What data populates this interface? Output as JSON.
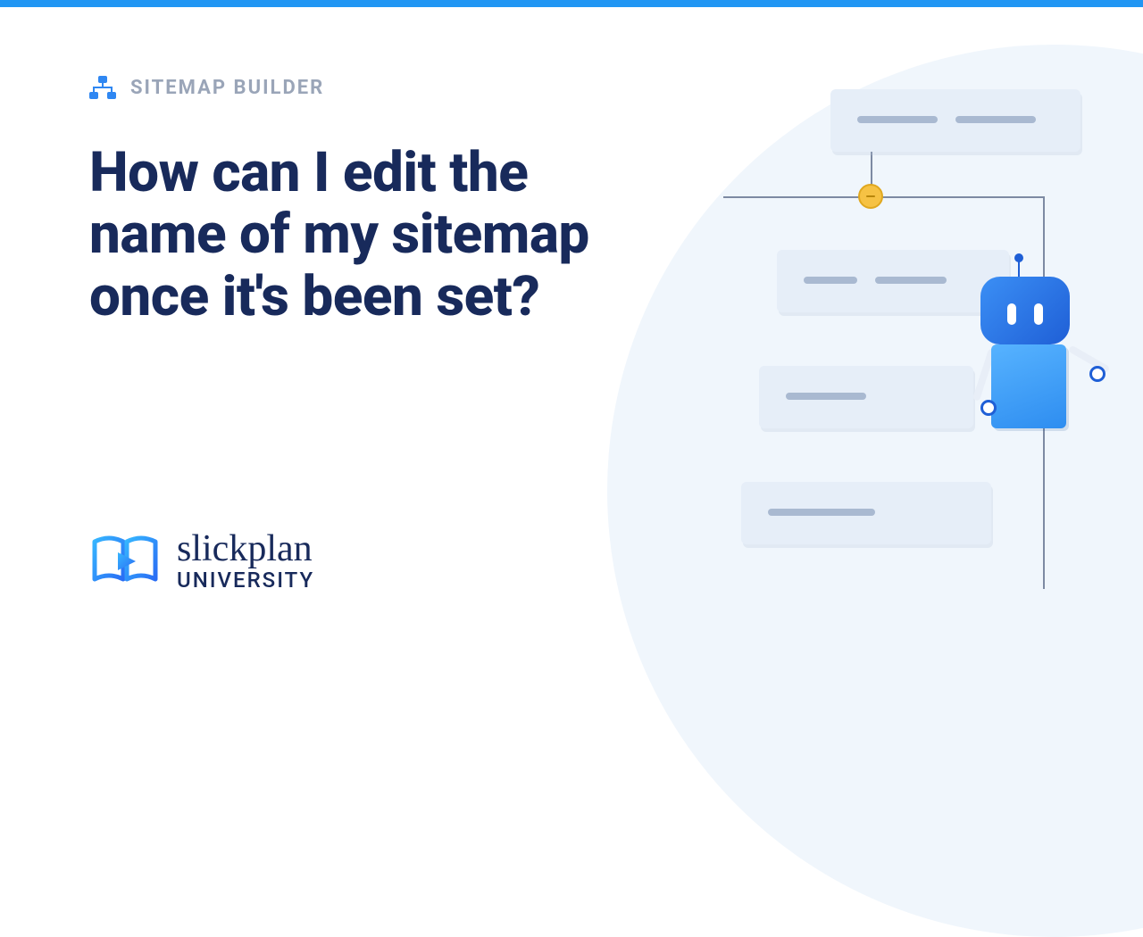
{
  "category": {
    "label": "SITEMAP BUILDER",
    "icon": "sitemap-icon"
  },
  "headline": "How can I edit the name of my sitemap once it's been set?",
  "brand": {
    "name": "slickplan",
    "sub": "UNIVERSITY",
    "icon": "book-play-icon"
  },
  "colors": {
    "accent": "#2196f3",
    "heading": "#182a5b",
    "muted": "#9aa5b8",
    "card": "#e6eef8"
  }
}
